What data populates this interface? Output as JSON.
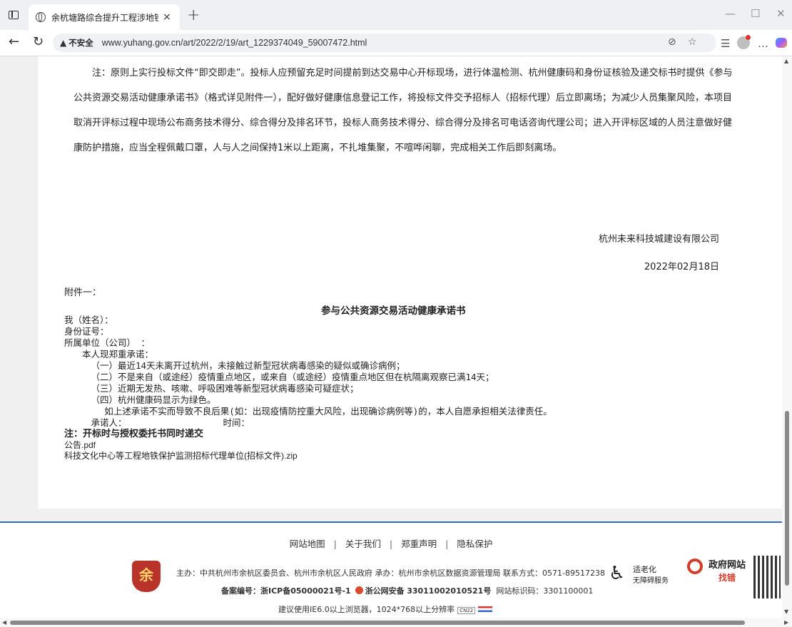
{
  "browser": {
    "tab_title": "余杭塘路综合提升工程涉地铁保护",
    "tab_close": "×",
    "new_tab": "+",
    "insecure_label": "不安全",
    "url": "www.yuhang.gov.cn/art/2022/2/19/art_1229374049_59007472.html"
  },
  "notice": {
    "text": "注：原则上实行投标文件“即交即走”。投标人应预留充足时间提前到达交易中心开标现场，进行体温检测、杭州健康码和身份证核验及递交标书时提供《参与公共资源交易活动健康承诺书》（格式详见附件一），配好做好健康信息登记工作，将投标文件交予招标人（招标代理）后立即离场；为减少人员集聚风险，本项目取消开评标过程中现场公布商务技术得分、综合得分及排名环节，投标人商务技术得分、综合得分及排名可电话咨询代理公司；进入开评标区域的人员注意做好健康防护措施，应当全程佩戴口罩，人与人之间保持1米以上距离，不扎堆集聚，不喧哗闲聊，完成相关工作后即刻离场。"
  },
  "company": "杭州未来科技城建设有限公司",
  "date": "2022年02月18日",
  "attachment_label": "附件一：",
  "pledge": {
    "title": "参与公共资源交易活动健康承诺书",
    "name": "我（姓名）：",
    "id": "身份证号：",
    "unit": "所属单位（公司）  ：",
    "intro": "本人现郑重承诺：",
    "item1": "（一）最近14天未离开过杭州，未接触过新型冠状病毒感染的疑似或确诊病例；",
    "item2": "（二）不是来自（或途经）疫情重点地区，或来自（或途经）疫情重点地区但在杭隔离观察已满14天；",
    "item3": "（三）近期无发热、咳嗽、呼吸困难等新型冠状病毒感染可疑症状；",
    "item4": "（四）杭州健康码显示为绿色。",
    "statement": "如上述承诺不实而导致不良后果(如：出现疫情防控重大风险，出现确诊病例等)的，本人自愿承担相关法律责任。",
    "signer": "承诺人：",
    "time": "时间：",
    "note": "注：开标时与授权委托书同时递交"
  },
  "files": [
    "公告.pdf",
    "科技文化中心等工程地铁保护监测招标代理单位(招标文件).zip"
  ],
  "footer": {
    "links": [
      "网站地图",
      "关于我们",
      "郑重声明",
      "隐私保护"
    ],
    "sep": "|",
    "line1": "主办：中共杭州市余杭区委员会、杭州市余杭区人民政府   承办：杭州市余杭区数据资源管理局   联系方式：0571-89517238",
    "record_label": "备案编号：浙ICP备05000021号-1",
    "police_label": "浙公网安备",
    "police_no": "33011002010521号",
    "site_code": "网站标识码：3301100001",
    "line3": "建议使用IE6.0以上浏览器，1024*768以上分辨率",
    "ch22": "CN22",
    "acc_t1": "适老化",
    "acc_t2": "无障碍服务",
    "gov_t1": "政府网站",
    "gov_t2": "找错",
    "emblem": "余"
  }
}
